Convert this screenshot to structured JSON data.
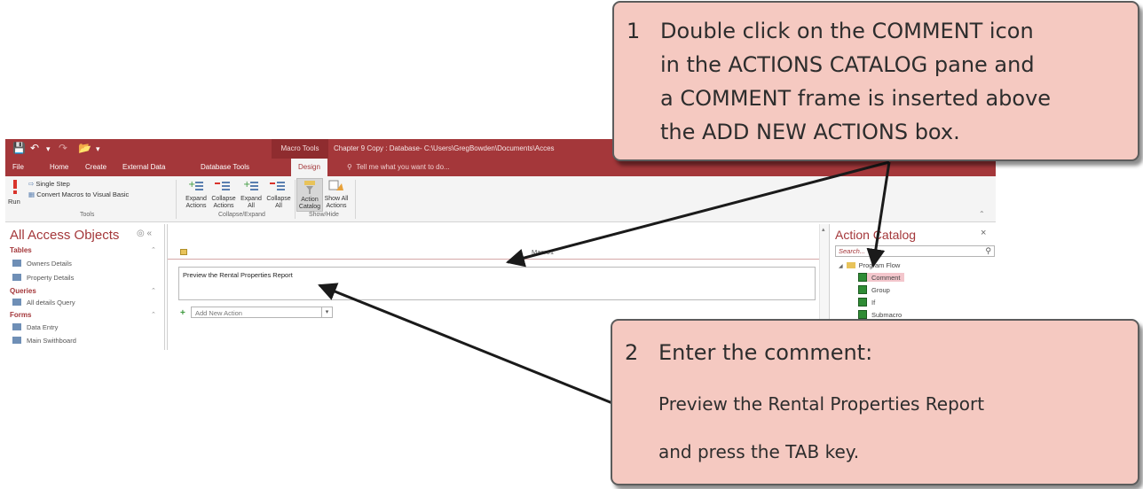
{
  "window": {
    "context_tab_label": "Macro Tools",
    "title": "Chapter 9 Copy : Database- C:\\Users\\GregBowden\\Documents\\Acces"
  },
  "tabs": [
    "File",
    "Home",
    "Create",
    "External Data",
    "Database Tools",
    "Design"
  ],
  "tell_me": "Tell me what you want to do...",
  "ribbon": {
    "run_label": "Run",
    "single_step_label": "Single Step",
    "convert_label": "Convert Macros to Visual Basic",
    "tools_group": "Tools",
    "expand_actions": [
      "Expand",
      "Actions"
    ],
    "collapse_actions": [
      "Collapse",
      "Actions"
    ],
    "expand_all": [
      "Expand",
      "All"
    ],
    "collapse_all": [
      "Collapse",
      "All"
    ],
    "collapse_expand_group": "Collapse/Expand",
    "action_catalog": [
      "Action",
      "Catalog"
    ],
    "show_all_actions": [
      "Show All",
      "Actions"
    ],
    "show_hide_group": "Show/Hide"
  },
  "nav": {
    "title": "All Access Objects",
    "sections": {
      "tables": "Tables",
      "queries": "Queries",
      "forms": "Forms"
    },
    "tables": [
      "Owners Details",
      "Property Details"
    ],
    "queries": [
      "All details Query"
    ],
    "forms": [
      "Data Entry",
      "Main Swithboard"
    ]
  },
  "editor": {
    "macro_name": "Macro1",
    "comment_text": "Preview the Rental Properties Report",
    "add_new_action_placeholder": "Add New Action"
  },
  "catalog": {
    "title": "Action Catalog",
    "search_placeholder": "Search...",
    "folder": "Program Flow",
    "items": [
      "Comment",
      "Group",
      "If",
      "Submacro"
    ]
  },
  "callout1": {
    "number": "1",
    "lines": [
      "Double click on the COMMENT icon",
      "in the ACTIONS CATALOG pane and",
      "a COMMENT frame is inserted above",
      "the ADD NEW ACTIONS box."
    ]
  },
  "callout2": {
    "number": "2",
    "lines": [
      "Enter the comment:",
      "Preview the Rental Properties Report",
      "and press the TAB key."
    ]
  }
}
